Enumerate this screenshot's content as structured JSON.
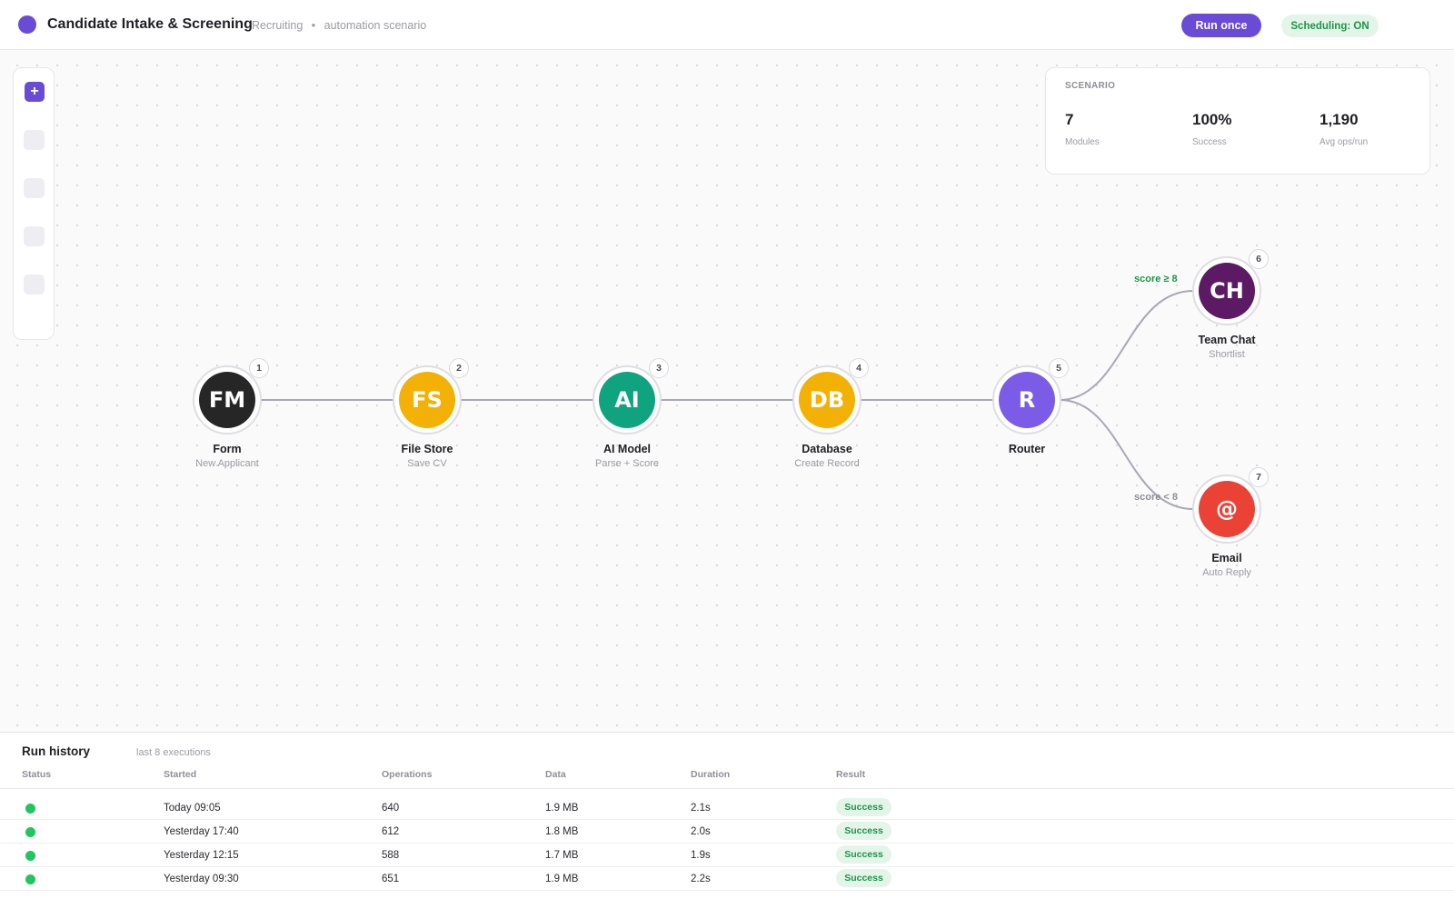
{
  "header": {
    "title": "Candidate Intake & Screening",
    "crumb_section": "Recruiting",
    "crumb_separator": "•",
    "crumb_type": "automation scenario",
    "run_button": "Run once",
    "scheduling_badge": "Scheduling: ON"
  },
  "colors": {
    "accent": "#6a4bd6",
    "success": "#1e9448",
    "success_bg": "#e3f5e9",
    "status_dot": "#22c55e"
  },
  "toolbar": {
    "add_icon": "+",
    "add_icon_name": "plus-icon"
  },
  "stats": {
    "label": "SCENARIO",
    "modules_value": "7",
    "modules_caption": "Modules",
    "success_value": "100%",
    "success_caption": "Success",
    "ops_value": "1,190",
    "ops_caption": "Avg ops/run"
  },
  "nodes": [
    {
      "num": "1",
      "initials": "FM",
      "name": "Form",
      "sub": "New Applicant",
      "color": "#262626"
    },
    {
      "num": "2",
      "initials": "FS",
      "name": "File Store",
      "sub": "Save CV",
      "color": "#f2b104"
    },
    {
      "num": "3",
      "initials": "AI",
      "name": "AI Model",
      "sub": "Parse + Score",
      "color": "#10a37f"
    },
    {
      "num": "4",
      "initials": "DB",
      "name": "Database",
      "sub": "Create Record",
      "color": "#f2b104"
    },
    {
      "num": "5",
      "initials": "R",
      "name": "Router",
      "sub": "",
      "color": "#7c5ce6"
    },
    {
      "num": "6",
      "initials": "CH",
      "name": "Team Chat",
      "sub": "Shortlist",
      "color": "#5b1a63"
    },
    {
      "num": "7",
      "initials": "@",
      "name": "Email",
      "sub": "Auto Reply",
      "color": "#ea4335"
    }
  ],
  "routes": {
    "upper_label": "score ≥ 8",
    "upper_color": "#1e9448",
    "lower_label": "score < 8",
    "lower_color": "#8e8e98"
  },
  "history": {
    "title": "Run history",
    "subtitle": "last 8 executions",
    "columns": [
      "Status",
      "Started",
      "Operations",
      "Data",
      "Duration",
      "Result"
    ],
    "rows": [
      {
        "started": "Today 09:05",
        "operations": "640",
        "data": "1.9 MB",
        "duration": "2.1s",
        "result": "Success"
      },
      {
        "started": "Yesterday 17:40",
        "operations": "612",
        "data": "1.8 MB",
        "duration": "2.0s",
        "result": "Success"
      },
      {
        "started": "Yesterday 12:15",
        "operations": "588",
        "data": "1.7 MB",
        "duration": "1.9s",
        "result": "Success"
      },
      {
        "started": "Yesterday 09:30",
        "operations": "651",
        "data": "1.9 MB",
        "duration": "2.2s",
        "result": "Success"
      }
    ]
  }
}
